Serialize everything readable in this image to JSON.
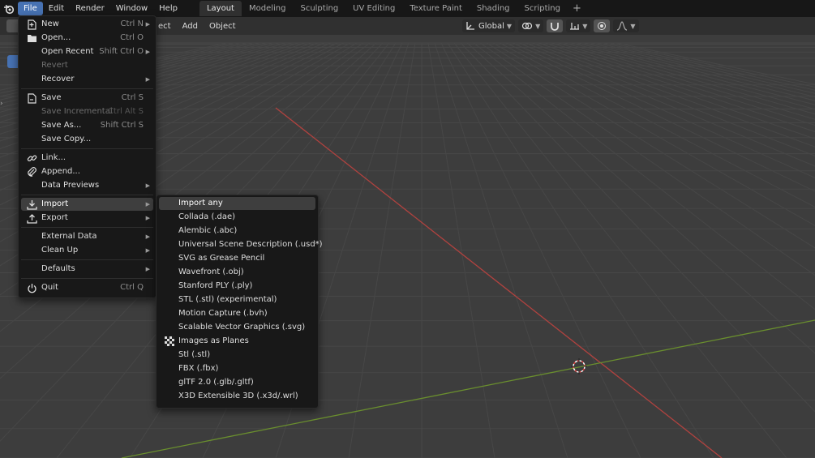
{
  "topbar": {
    "menus": [
      "File",
      "Edit",
      "Render",
      "Window",
      "Help"
    ],
    "workspaces": [
      "Layout",
      "Modeling",
      "Sculpting",
      "UV Editing",
      "Texture Paint",
      "Shading",
      "Scripting"
    ],
    "active_workspace": "Layout",
    "add_tab_label": "+"
  },
  "header": {
    "menus": [
      "ect",
      "Add",
      "Object"
    ],
    "orientation": "Global"
  },
  "file_menu": {
    "items": [
      {
        "label": "New",
        "shortcut": "Ctrl N",
        "icon": "new-file-icon",
        "submenu": true
      },
      {
        "label": "Open...",
        "shortcut": "Ctrl O",
        "icon": "folder-icon"
      },
      {
        "label": "Open Recent",
        "shortcut": "Shift Ctrl O",
        "submenu": true
      },
      {
        "label": "Revert",
        "disabled": true
      },
      {
        "label": "Recover",
        "submenu": true
      },
      {
        "label": "Save",
        "shortcut": "Ctrl S",
        "icon": "save-icon"
      },
      {
        "label": "Save Incremental",
        "shortcut": "Ctrl Alt S",
        "disabled": true
      },
      {
        "label": "Save As...",
        "shortcut": "Shift Ctrl S"
      },
      {
        "label": "Save Copy..."
      },
      {
        "label": "Link...",
        "icon": "link-icon"
      },
      {
        "label": "Append...",
        "icon": "append-icon"
      },
      {
        "label": "Data Previews",
        "submenu": true
      },
      {
        "label": "Import",
        "icon": "import-icon",
        "submenu": true,
        "highlighted": true
      },
      {
        "label": "Export",
        "icon": "export-icon",
        "submenu": true
      },
      {
        "label": "External Data",
        "submenu": true
      },
      {
        "label": "Clean Up",
        "submenu": true
      },
      {
        "label": "Defaults",
        "submenu": true
      },
      {
        "label": "Quit",
        "shortcut": "Ctrl Q",
        "icon": "power-icon"
      }
    ]
  },
  "import_menu": {
    "items": [
      {
        "label": "Import any",
        "highlighted": true
      },
      {
        "label": "Collada (.dae)"
      },
      {
        "label": "Alembic (.abc)"
      },
      {
        "label": "Universal Scene Description (.usd*)"
      },
      {
        "label": "SVG as Grease Pencil"
      },
      {
        "label": "Wavefront (.obj)"
      },
      {
        "label": "Stanford PLY (.ply)"
      },
      {
        "label": "STL (.stl) (experimental)"
      },
      {
        "label": "Motion Capture (.bvh)"
      },
      {
        "label": "Scalable Vector Graphics (.svg)"
      },
      {
        "label": "Images as Planes",
        "icon": "checkerboard-icon"
      },
      {
        "label": "Stl (.stl)"
      },
      {
        "label": "FBX (.fbx)"
      },
      {
        "label": "glTF 2.0 (.glb/.gltf)"
      },
      {
        "label": "X3D Extensible 3D (.x3d/.wrl)"
      }
    ]
  },
  "colors": {
    "accent": "#4772b3",
    "background": "#3d3d3d",
    "x_axis": "#b0423f",
    "y_axis": "#6a8f2e"
  }
}
